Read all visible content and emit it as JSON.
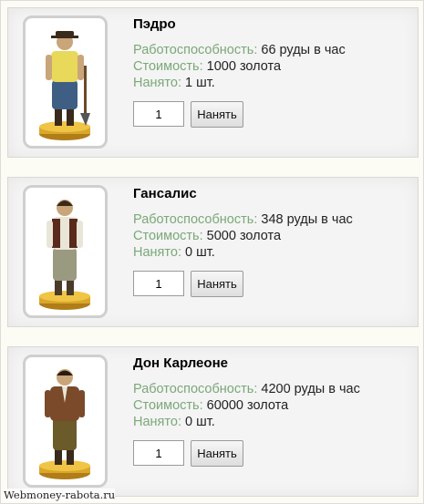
{
  "workers": [
    {
      "name": "Пэдро",
      "productivity_label": "Работоспособность:",
      "productivity_value": "66 руды в час",
      "cost_label": "Стоимость:",
      "cost_value": "1000 золота",
      "hired_label": "Нанято:",
      "hired_value": "1 шт.",
      "quantity": "1",
      "hire_button": "Нанять",
      "shirt_color": "#e8d95a",
      "pants_color": "#3e5f83"
    },
    {
      "name": "Гансалис",
      "productivity_label": "Работоспособность:",
      "productivity_value": "348 руды в час",
      "cost_label": "Стоимость:",
      "cost_value": "5000 золота",
      "hired_label": "Нанято:",
      "hired_value": "0 шт.",
      "quantity": "1",
      "hire_button": "Нанять",
      "shirt_color": "#e9e6d8",
      "pants_color": "#9a9a80"
    },
    {
      "name": "Дон Карлеоне",
      "productivity_label": "Работоспособность:",
      "productivity_value": "4200 руды в час",
      "cost_label": "Стоимость:",
      "cost_value": "60000 золота",
      "hired_label": "Нанято:",
      "hired_value": "0 шт.",
      "quantity": "1",
      "hire_button": "Нанять",
      "shirt_color": "#7a4a2a",
      "pants_color": "#6b5a2a"
    }
  ],
  "watermark": "Webmoney-rabota.ru",
  "colors": {
    "label_green": "#7ba879",
    "card_bg": "#f4f4f4",
    "page_bg": "#fdfcf4",
    "pedestal_gold": "#d9a72a"
  }
}
